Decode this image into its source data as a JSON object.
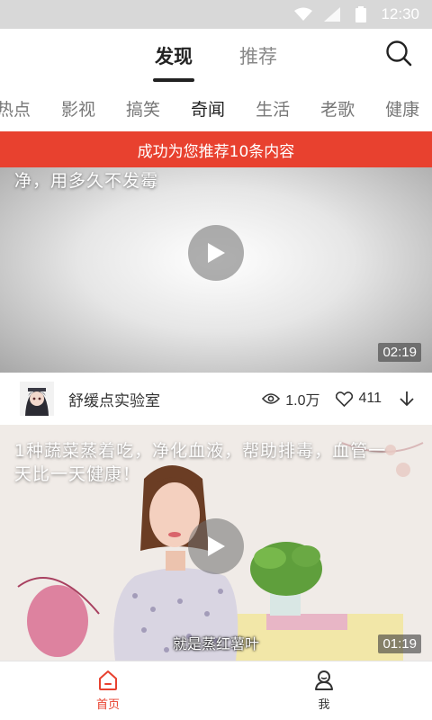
{
  "status_bar": {
    "time": "12:30"
  },
  "top_tabs": [
    {
      "label": "发现",
      "active": true
    },
    {
      "label": "推荐",
      "active": false
    }
  ],
  "categories": [
    {
      "label": "热点",
      "active": false
    },
    {
      "label": "影视",
      "active": false
    },
    {
      "label": "搞笑",
      "active": false
    },
    {
      "label": "奇闻",
      "active": true
    },
    {
      "label": "生活",
      "active": false
    },
    {
      "label": "老歌",
      "active": false
    },
    {
      "label": "健康",
      "active": false
    }
  ],
  "banner": {
    "text": "成功为您推荐10条内容"
  },
  "feed": [
    {
      "title": "净，用多久不发霉",
      "duration": "02:19",
      "author": "舒缓点实验室",
      "views": "1.0万",
      "likes": "411"
    },
    {
      "title_line1": "1种蔬菜蒸着吃，净化血液，帮助排毒，血管一",
      "title_line2": "天比一天健康！",
      "duration": "01:19",
      "subtitle": "就是蒸红薯叶"
    }
  ],
  "bottom_nav": [
    {
      "label": "首页",
      "icon": "home-icon",
      "active": true
    },
    {
      "label": "我",
      "icon": "profile-icon",
      "active": false
    }
  ],
  "colors": {
    "accent": "#e8412f",
    "status_bar": "#d8d8d8"
  }
}
